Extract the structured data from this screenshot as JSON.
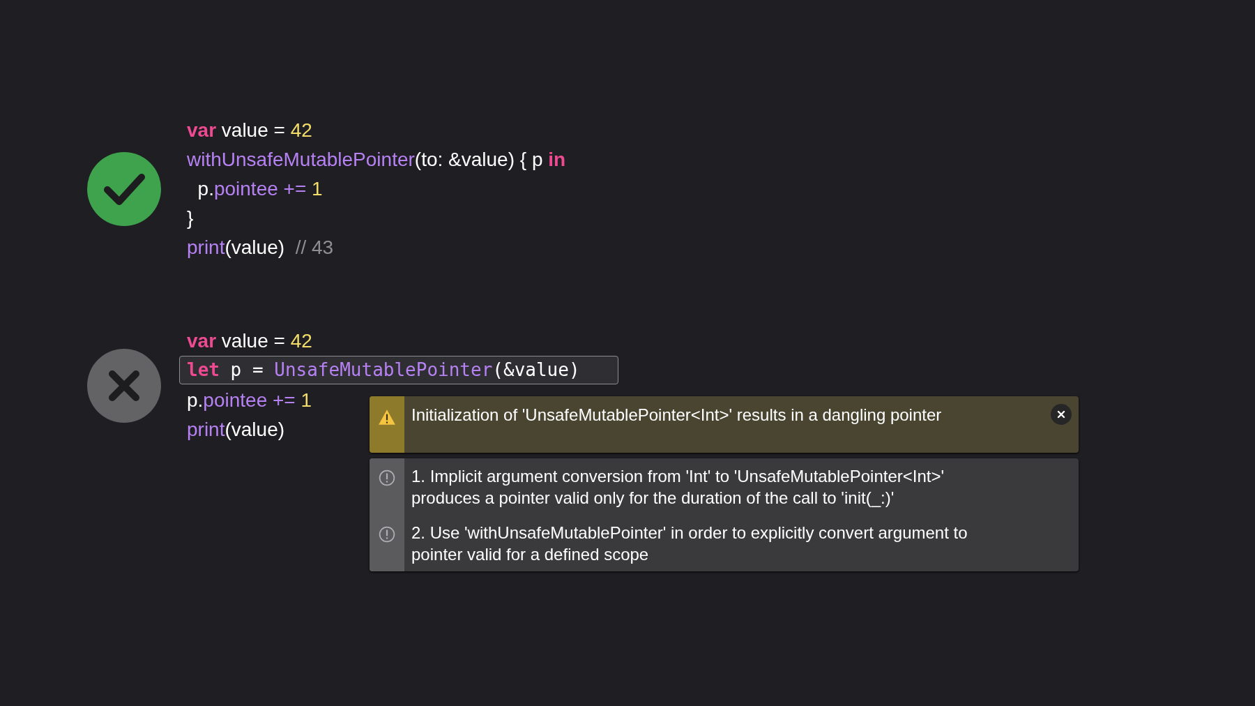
{
  "examples": [
    {
      "kind": "correct",
      "lines": [
        {
          "highlighted": false,
          "tokens": [
            {
              "kind": "keyword",
              "t": "var"
            },
            {
              "kind": "plain",
              "t": " value = "
            },
            {
              "kind": "number",
              "t": "42"
            }
          ]
        },
        {
          "highlighted": false,
          "tokens": [
            {
              "kind": "function",
              "t": "withUnsafeMutablePointer"
            },
            {
              "kind": "plain",
              "t": "(to: &value) { p "
            },
            {
              "kind": "keyword",
              "t": "in"
            }
          ]
        },
        {
          "highlighted": false,
          "tokens": [
            {
              "kind": "plain",
              "t": "  p."
            },
            {
              "kind": "function",
              "t": "pointee"
            },
            {
              "kind": "function",
              "t": " +="
            },
            {
              "kind": "number",
              "t": " 1"
            }
          ]
        },
        {
          "highlighted": false,
          "tokens": [
            {
              "kind": "plain",
              "t": "}"
            }
          ]
        },
        {
          "highlighted": false,
          "tokens": [
            {
              "kind": "function",
              "t": "print"
            },
            {
              "kind": "plain",
              "t": "(value)  "
            },
            {
              "kind": "comment",
              "t": "// 43"
            }
          ]
        }
      ]
    },
    {
      "kind": "wrong",
      "lines": [
        {
          "highlighted": false,
          "tokens": [
            {
              "kind": "keyword",
              "t": "var"
            },
            {
              "kind": "plain",
              "t": " value = "
            },
            {
              "kind": "number",
              "t": "42"
            }
          ]
        },
        {
          "highlighted": true,
          "tokens": [
            {
              "kind": "keyword",
              "t": "let"
            },
            {
              "kind": "plain",
              "t": " p = "
            },
            {
              "kind": "function",
              "t": "UnsafeMutablePointer"
            },
            {
              "kind": "plain",
              "t": "(&value)"
            }
          ]
        },
        {
          "highlighted": false,
          "tokens": [
            {
              "kind": "plain",
              "t": "p."
            },
            {
              "kind": "function",
              "t": "pointee"
            },
            {
              "kind": "function",
              "t": " +="
            },
            {
              "kind": "number",
              "t": " 1"
            }
          ]
        },
        {
          "highlighted": false,
          "tokens": [
            {
              "kind": "function",
              "t": "print"
            },
            {
              "kind": "plain",
              "t": "(value)"
            }
          ]
        }
      ],
      "diagnostic": {
        "warning": "Initialization of 'UnsafeMutablePointer<Int>' results in a dangling pointer",
        "notes": [
          "1. Implicit argument conversion from 'Int' to 'UnsafeMutablePointer<Int>' produces a pointer valid only for the duration of the call to 'init(_:)'",
          "2. Use 'withUnsafeMutablePointer' in order to explicitly convert argument to pointer valid for a defined scope"
        ]
      }
    }
  ]
}
